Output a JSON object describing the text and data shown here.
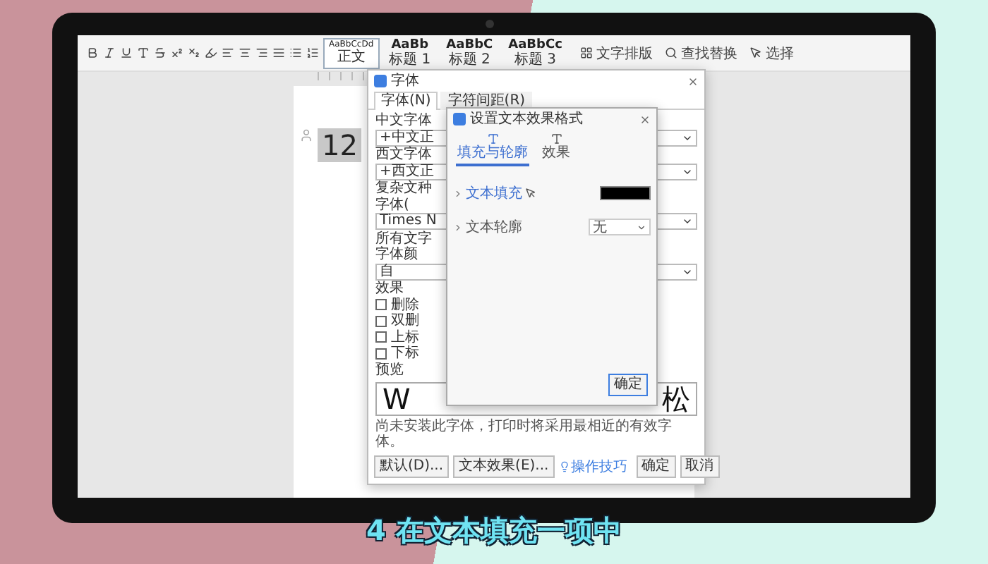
{
  "toolbar": {
    "styles": [
      {
        "sample": "AaBbCcDd",
        "label": "正文",
        "selected": true
      },
      {
        "sample": "AaBb",
        "label": "标题 1",
        "selected": false
      },
      {
        "sample": "AaBbC",
        "label": "标题 2",
        "selected": false
      },
      {
        "sample": "AaBbCc",
        "label": "标题 3",
        "selected": false
      }
    ],
    "tools": [
      "文字排版",
      "查找替换",
      "选择"
    ]
  },
  "document": {
    "text": "12"
  },
  "font_dialog": {
    "title": "字体",
    "tabs": [
      {
        "label": "字体(N)",
        "selected": true
      },
      {
        "label": "字符间距(R)",
        "selected": false
      }
    ],
    "sections": [
      {
        "kind": "label",
        "text": "中文字体"
      },
      {
        "kind": "field",
        "text": "+中文正"
      },
      {
        "kind": "label",
        "text": "西文字体"
      },
      {
        "kind": "field",
        "text": "+西文正"
      },
      {
        "kind": "label",
        "text": "复杂文种"
      },
      {
        "kind": "label",
        "text": "字体("
      },
      {
        "kind": "field",
        "text": "Times N"
      },
      {
        "kind": "label",
        "text": "所有文字"
      },
      {
        "kind": "label",
        "text": "字体颜"
      },
      {
        "kind": "field",
        "text": "自"
      },
      {
        "kind": "label",
        "text": "效果"
      },
      {
        "kind": "checkbox",
        "text": "删除",
        "checked": false
      },
      {
        "kind": "checkbox",
        "text": "双删",
        "checked": false
      },
      {
        "kind": "checkbox",
        "text": "上标",
        "checked": false
      },
      {
        "kind": "checkbox",
        "text": "下标",
        "checked": false
      },
      {
        "kind": "label",
        "text": "预览"
      }
    ],
    "preview_left": "W",
    "preview_right": "松",
    "note": "尚未安装此字体，打印时将采用最相近的有效字体。",
    "buttons": [
      "默认(D)...",
      "文本效果(E)..."
    ],
    "tips": "操作技巧",
    "ok": "确定",
    "cancel": "取消"
  },
  "effects_dialog": {
    "title": "设置文本效果格式",
    "tabs": [
      {
        "label": "填充与轮廓",
        "selected": true
      },
      {
        "label": "效果",
        "selected": false
      }
    ],
    "rows": [
      {
        "kind": "swatch",
        "label": "文本填充",
        "highlighted": true
      },
      {
        "kind": "select",
        "label": "文本轮廓",
        "value": "无",
        "highlighted": false
      }
    ],
    "ok": "确定"
  },
  "subtitle": "4 在文本填充一项中"
}
